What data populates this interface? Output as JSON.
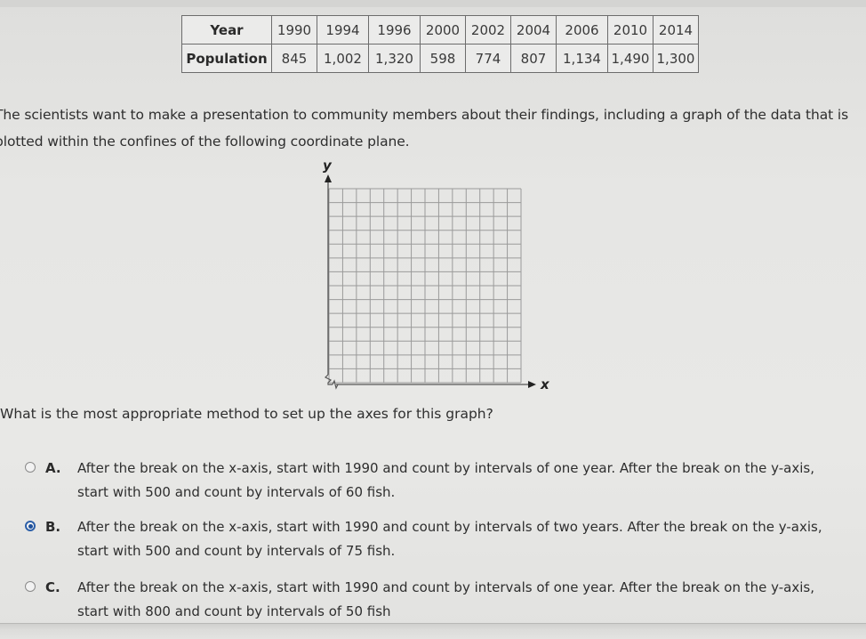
{
  "table": {
    "row_headers": [
      "Year",
      "Population"
    ],
    "years": [
      "1990",
      "1994",
      "1996",
      "2000",
      "2002",
      "2004",
      "2006",
      "2010",
      "2014"
    ],
    "populations": [
      "845",
      "1,002",
      "1,320",
      "598",
      "774",
      "807",
      "1,134",
      "1,490",
      "1,300"
    ]
  },
  "prompt": {
    "line1": "The scientists want to make a presentation to community members about their findings, including a graph of the data that is",
    "line2": "plotted within the confines of the following coordinate plane."
  },
  "coordinate_plane": {
    "x_label": "x",
    "y_label": "y",
    "grid_columns": 14,
    "grid_rows": 14,
    "x_axis_break": true,
    "y_axis_break": true
  },
  "question": "What is the most appropriate method to set up the axes for this graph?",
  "options": [
    {
      "letter": "A.",
      "line1": "After the break on the x-axis, start with 1990 and count by intervals of one year. After the break on the y-axis,",
      "line2": "start with 500 and count by intervals of 60 fish.",
      "selected": false
    },
    {
      "letter": "B.",
      "line1": "After the break on the x-axis, start with 1990 and count by intervals of two years. After the break on the y-axis,",
      "line2": "start with 500 and count by intervals of 75 fish.",
      "selected": true
    },
    {
      "letter": "C.",
      "line1": "After the break on the x-axis, start with 1990 and count by intervals of one year. After the break on the y-axis,",
      "line2": "start with 800 and count by intervals of 50 fish",
      "selected": false
    }
  ],
  "colors": {
    "selected_radio": "#1d4f9a",
    "background": "#e6e6e4",
    "grid_line": "#9a9a9a"
  }
}
